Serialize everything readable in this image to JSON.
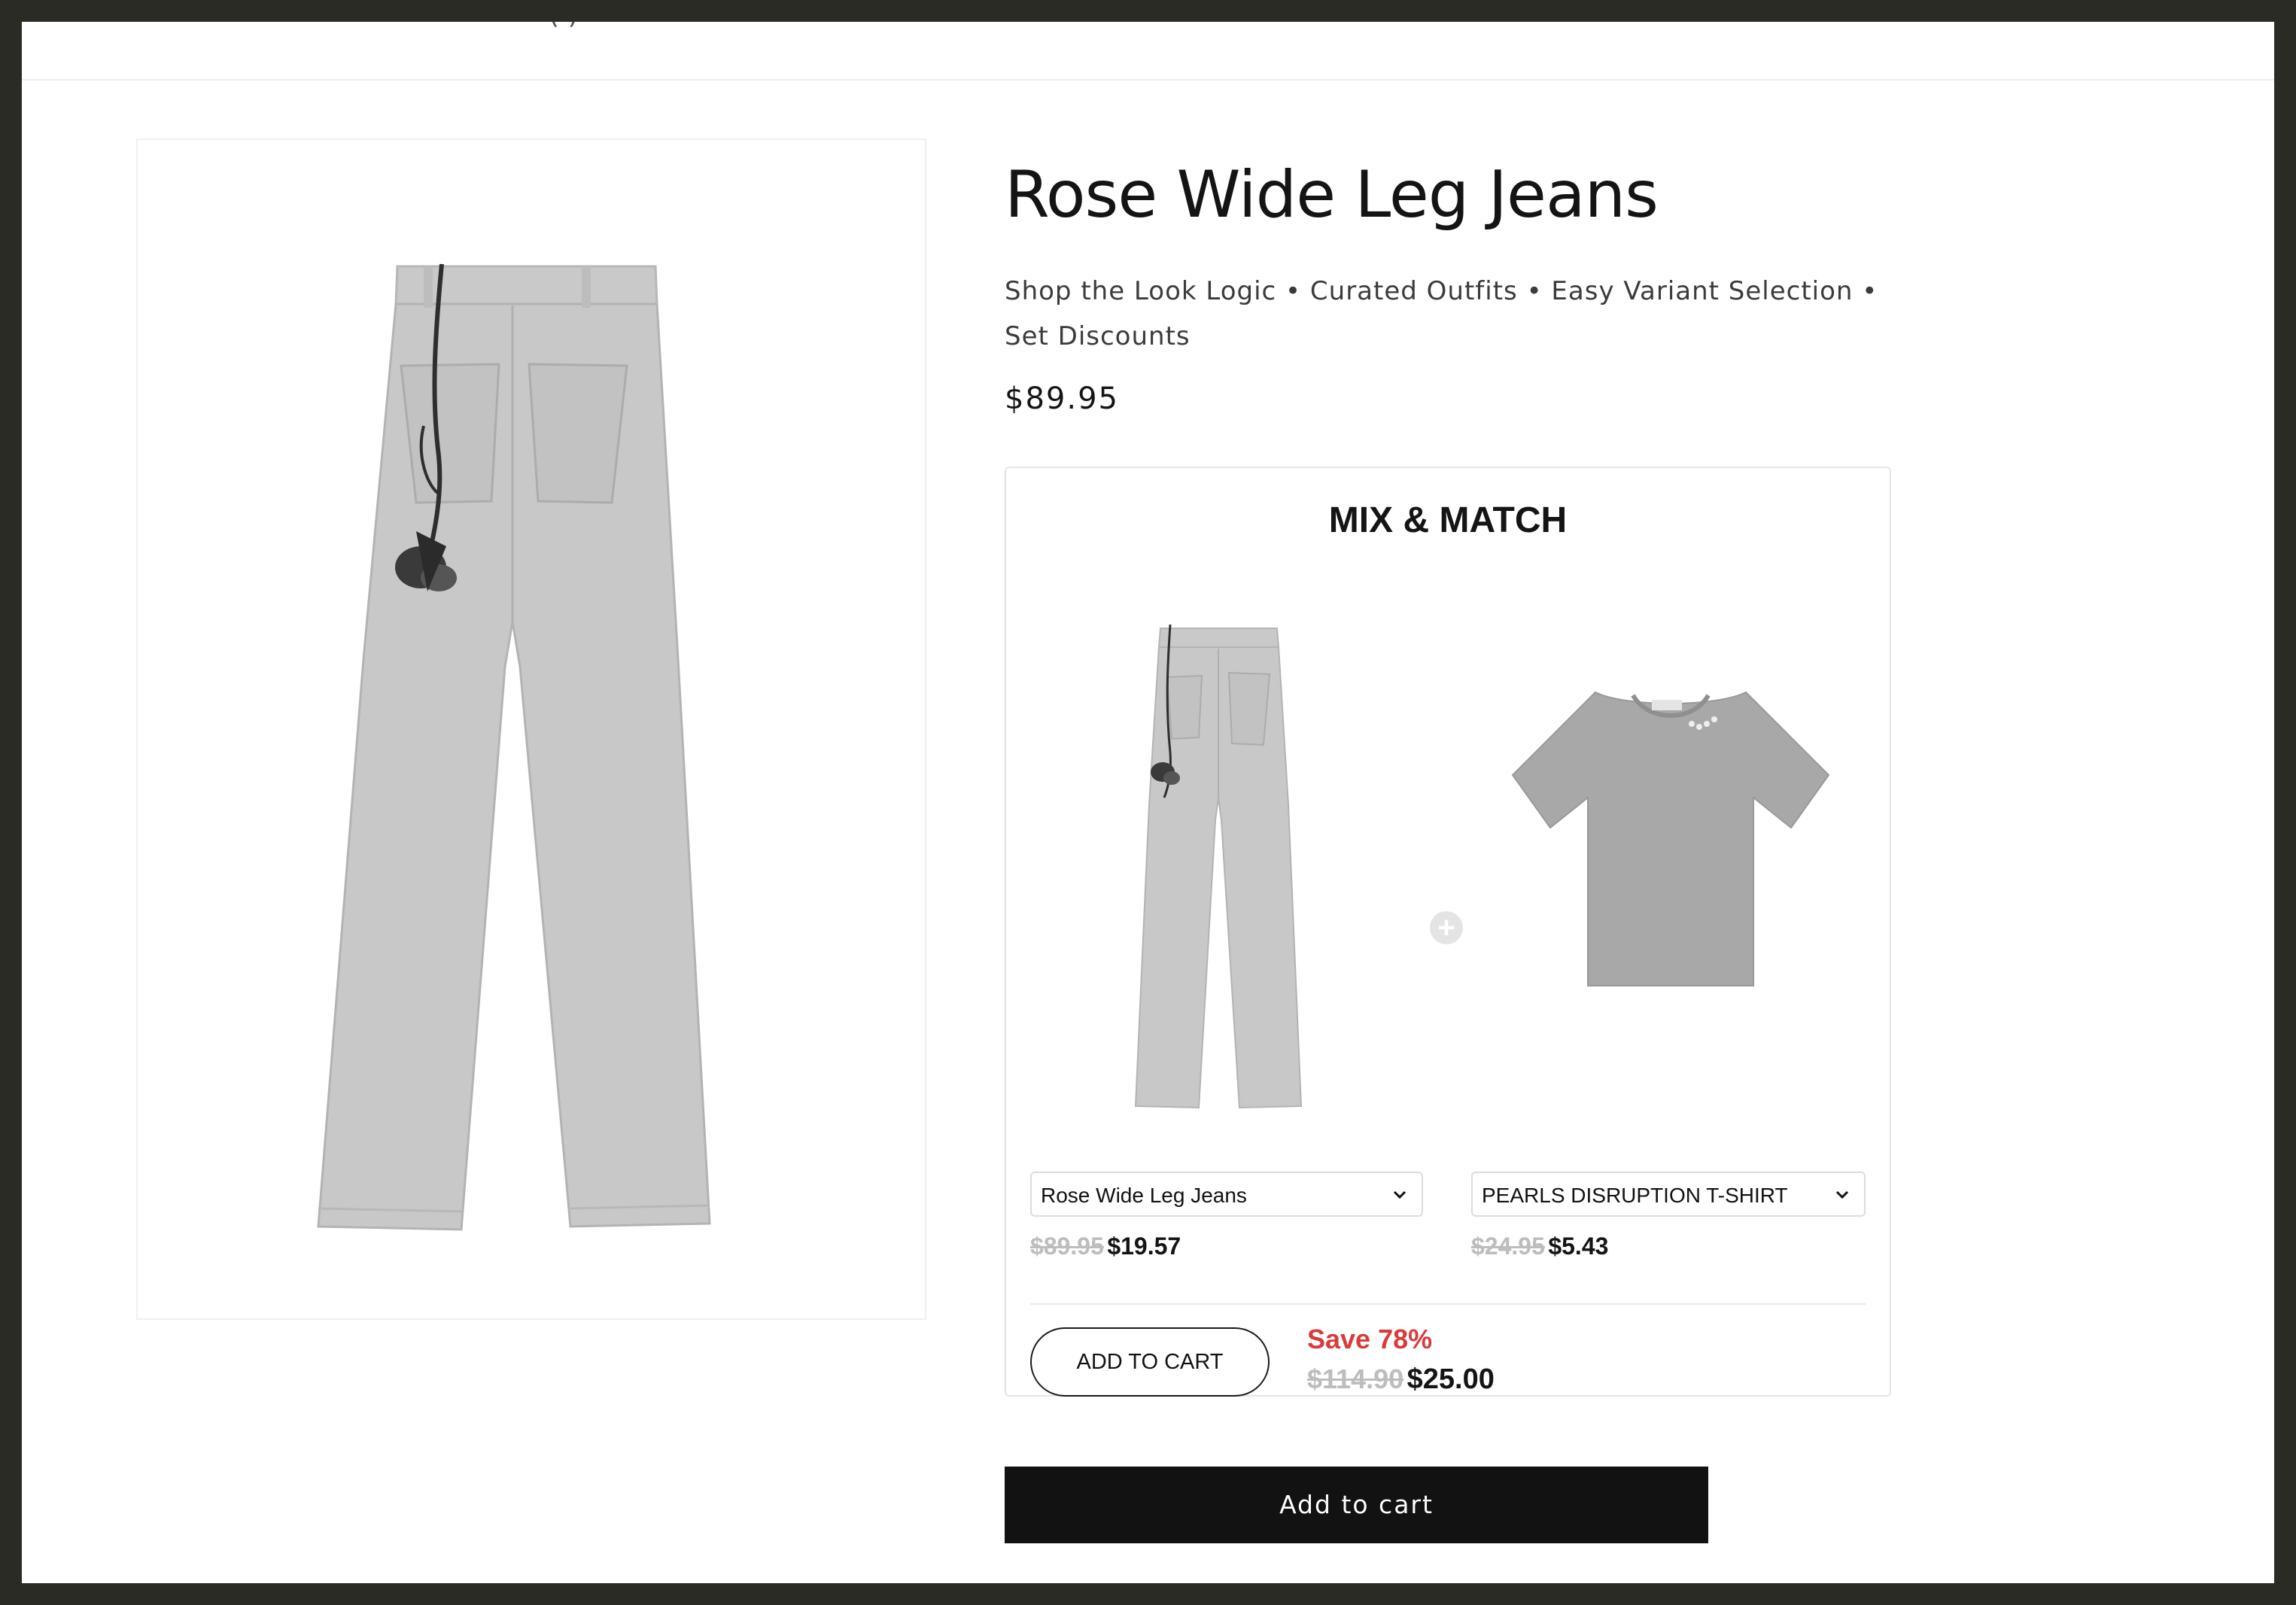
{
  "header": {
    "cut_text": "(                        )"
  },
  "product": {
    "title": "Rose Wide Leg Jeans",
    "features": "Shop the Look Logic • Curated Outfits • Easy Variant Selection • Set Discounts",
    "price": "$89.95",
    "image_icon": "jeans-image"
  },
  "mix_match": {
    "title": "MIX & MATCH",
    "items": [
      {
        "image_icon": "jeans-image",
        "select_value": "Rose Wide Leg Jeans",
        "old_price": "$89.95",
        "new_price": "$19.57"
      },
      {
        "image_icon": "tshirt-image",
        "select_value": "PEARLS DISRUPTION T-SHIRT",
        "old_price": "$24.95",
        "new_price": "$5.43"
      }
    ],
    "plus_icon": "plus-circle-icon",
    "add_to_cart_label": "ADD TO CART",
    "save_label": "Save 78%",
    "bundle_old_price": "$114.90",
    "bundle_new_price": "$25.00"
  },
  "main_cart_label": "Add to cart",
  "colors": {
    "save_red": "#d93b3b",
    "cart_button_bg": "#121212"
  }
}
